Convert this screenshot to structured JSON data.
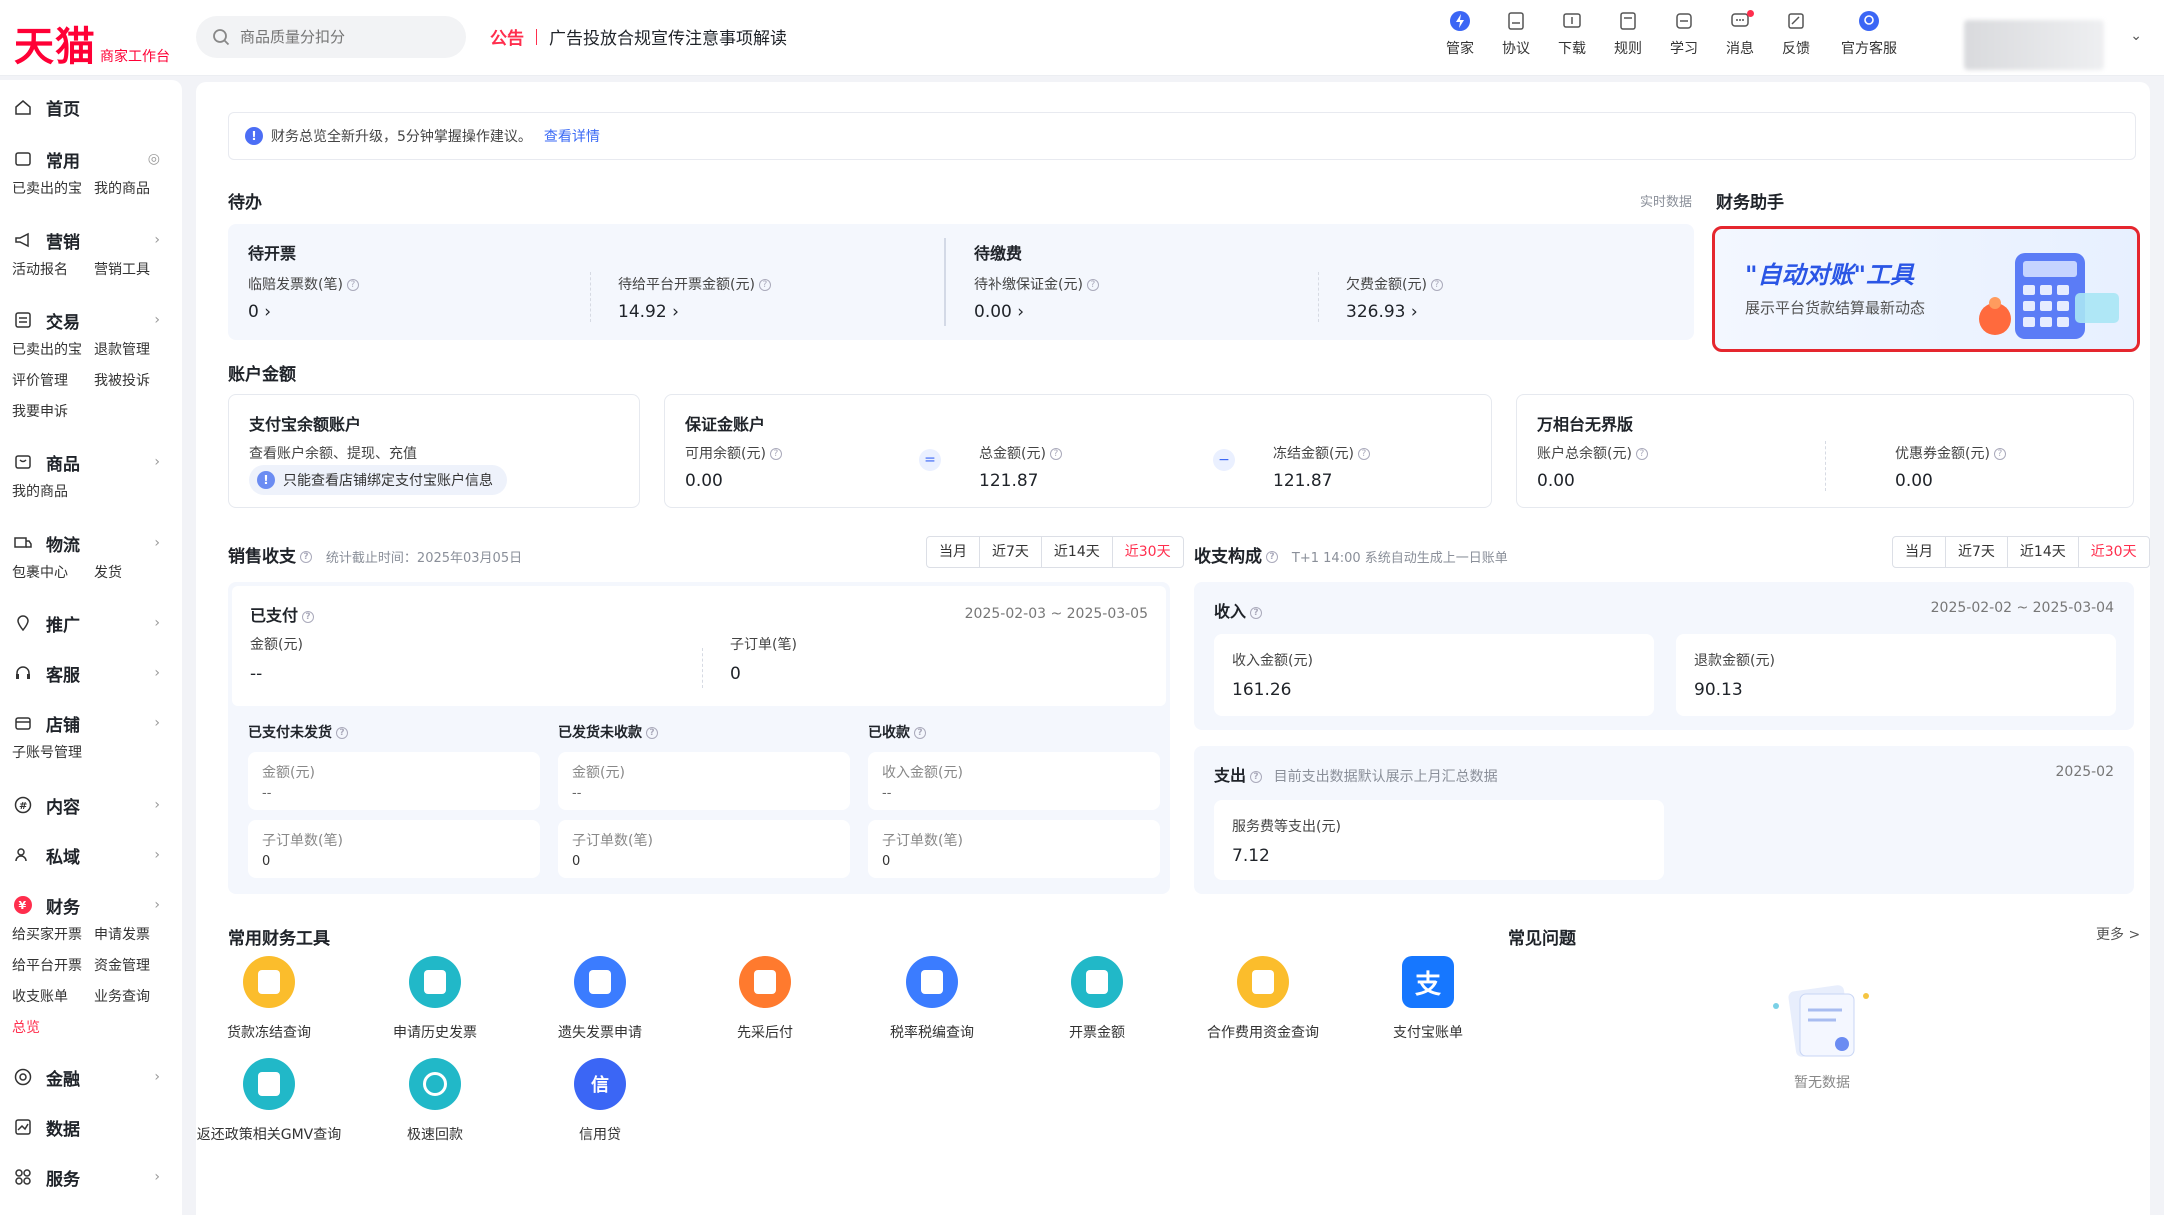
{
  "header": {
    "logo_main": "天猫",
    "logo_sub": "商家工作台",
    "search_placeholder": "商品质量分扣分",
    "notice_tag": "公告",
    "notice_text": "广告投放合规宣传注意事项解读",
    "tools": [
      {
        "label": "管家",
        "icon": "lightning-icon"
      },
      {
        "label": "协议",
        "icon": "agreement-icon"
      },
      {
        "label": "下载",
        "icon": "download-icon"
      },
      {
        "label": "规则",
        "icon": "rules-icon"
      },
      {
        "label": "学习",
        "icon": "study-icon"
      },
      {
        "label": "消息",
        "icon": "message-icon"
      },
      {
        "label": "反馈",
        "icon": "feedback-icon"
      },
      {
        "label": "官方客服",
        "icon": "support-icon"
      }
    ]
  },
  "sidebar": {
    "home": "首页",
    "common": "常用",
    "common_subs": [
      "已卖出的宝",
      "我的商品"
    ],
    "marketing": "营销",
    "marketing_subs": [
      "活动报名",
      "营销工具"
    ],
    "trade": "交易",
    "trade_subs": [
      "已卖出的宝",
      "退款管理",
      "评价管理",
      "我被投诉",
      "我要申诉"
    ],
    "goods": "商品",
    "goods_subs": [
      "我的商品"
    ],
    "logistics": "物流",
    "logistics_subs": [
      "包裹中心",
      "发货"
    ],
    "promotion": "推广",
    "service_cs": "客服",
    "shop": "店铺",
    "shop_subs": [
      "子账号管理"
    ],
    "content": "内容",
    "private": "私域",
    "finance": "财务",
    "finance_subs": [
      "给买家开票",
      "申请发票",
      "给平台开票",
      "资金管理",
      "收支账单",
      "业务查询",
      "总览"
    ],
    "jinrong": "金融",
    "data": "数据",
    "services": "服务"
  },
  "info": {
    "text": "财务总览全新升级，5分钟掌握操作建议。",
    "link": "查看详情"
  },
  "todo": {
    "title": "待办",
    "realtime": "实时数据",
    "invoice_title": "待开票",
    "invoice_items": [
      {
        "label": "临赔发票数(笔)",
        "value": "0"
      },
      {
        "label": "待给平台开票金额(元)",
        "value": "14.92"
      }
    ],
    "fee_title": "待缴费",
    "fee_items": [
      {
        "label": "待补缴保证金(元)",
        "value": "0.00"
      },
      {
        "label": "欠费金额(元)",
        "value": "326.93"
      }
    ]
  },
  "assistant": {
    "title": "财务助手",
    "banner_title": "\"自动对账\"工具",
    "banner_desc": "展示平台货款结算最新动态"
  },
  "account": {
    "title": "账户金额",
    "alipay_title": "支付宝余额账户",
    "alipay_desc": "查看账户余额、提现、充值",
    "alipay_hint": "只能查看店铺绑定支付宝账户信息",
    "deposit_title": "保证金账户",
    "deposit_items": [
      {
        "label": "可用余额(元)",
        "value": "0.00"
      },
      {
        "label": "总金额(元)",
        "value": "121.87"
      },
      {
        "label": "冻结金额(元)",
        "value": "121.87"
      }
    ],
    "eq": "=",
    "minus": "−",
    "wanxiang_title": "万相台无界版",
    "wanxiang_items": [
      {
        "label": "账户总余额(元)",
        "value": "0.00"
      },
      {
        "label": "优惠券金额(元)",
        "value": "0.00"
      }
    ]
  },
  "sales": {
    "title": "销售收支",
    "stat_note": "统计截止时间：2025年03月05日",
    "ranges": [
      "当月",
      "近7天",
      "近14天",
      "近30天"
    ],
    "paid_title": "已支付",
    "paid_range": "2025-02-03 ~ 2025-03-05",
    "paid_amount_label": "金额(元)",
    "paid_amount_value": "--",
    "paid_orders_label": "子订单(笔)",
    "paid_orders_value": "0",
    "subs": [
      {
        "title": "已支付未发货",
        "amount_label": "金额(元)",
        "amount": "--",
        "orders_label": "子订单数(笔)",
        "orders": "0"
      },
      {
        "title": "已发货未收款",
        "amount_label": "金额(元)",
        "amount": "--",
        "orders_label": "子订单数(笔)",
        "orders": "0"
      },
      {
        "title": "已收款",
        "amount_label": "收入金额(元)",
        "amount": "--",
        "orders_label": "子订单数(笔)",
        "orders": "0"
      }
    ]
  },
  "composition": {
    "title": "收支构成",
    "note": "T+1 14:00 系统自动生成上一日账单",
    "ranges": [
      "当月",
      "近7天",
      "近14天",
      "近30天"
    ],
    "income_title": "收入",
    "income_range": "2025-02-02 ~ 2025-03-04",
    "income_label": "收入金额(元)",
    "income_value": "161.26",
    "refund_label": "退款金额(元)",
    "refund_value": "90.13",
    "expense_title": "支出",
    "expense_note": "目前支出数据默认展示上月汇总数据",
    "expense_month": "2025-02",
    "expense_label": "服务费等支出(元)",
    "expense_value": "7.12"
  },
  "tools": {
    "title": "常用财务工具",
    "items": [
      {
        "label": "货款冻结查询",
        "color": "#fbbd2c"
      },
      {
        "label": "申请历史发票",
        "color": "#21b8c8"
      },
      {
        "label": "遗失发票申请",
        "color": "#3b7cff"
      },
      {
        "label": "先采后付",
        "color": "#ff7a2e"
      },
      {
        "label": "税率税编查询",
        "color": "#3b7cff"
      },
      {
        "label": "开票金额",
        "color": "#21b8c8"
      },
      {
        "label": "合作费用资金查询",
        "color": "#fbbd2c"
      },
      {
        "label": "支付宝账单",
        "color": "#1677ff"
      },
      {
        "label": "返还政策相关GMV查询",
        "color": "#21b8c8"
      },
      {
        "label": "极速回款",
        "color": "#21b8c8"
      },
      {
        "label": "信用贷",
        "color": "#3b66f5"
      }
    ]
  },
  "faq": {
    "title": "常见问题",
    "more": "更多 >",
    "empty": "暂无数据"
  }
}
